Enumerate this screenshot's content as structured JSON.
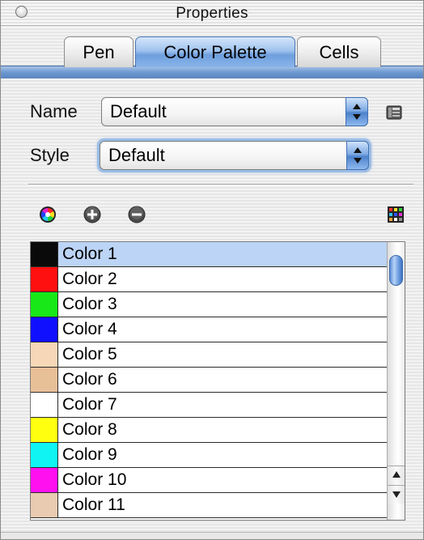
{
  "window": {
    "title": "Properties"
  },
  "tabs": [
    {
      "label": "Pen",
      "selected": false
    },
    {
      "label": "Color Palette",
      "selected": true
    },
    {
      "label": "Cells",
      "selected": false
    }
  ],
  "form": {
    "name_label": "Name",
    "name_value": "Default",
    "style_label": "Style",
    "style_value": "Default"
  },
  "toolbar": {
    "icons": [
      "color-wheel-icon",
      "add-icon",
      "remove-icon",
      "palette-grid-icon"
    ]
  },
  "colors": [
    {
      "label": "Color 1",
      "swatch": "#0a0a0a",
      "selected": true
    },
    {
      "label": "Color 2",
      "swatch": "#ff1010"
    },
    {
      "label": "Color 3",
      "swatch": "#18e818"
    },
    {
      "label": "Color 4",
      "swatch": "#1010ff"
    },
    {
      "label": "Color 5",
      "swatch": "#f6d8b8"
    },
    {
      "label": "Color 6",
      "swatch": "#e8c098"
    },
    {
      "label": "Color 7",
      "swatch": "#ffffff"
    },
    {
      "label": "Color 8",
      "swatch": "#ffff10"
    },
    {
      "label": "Color 9",
      "swatch": "#10f4f4"
    },
    {
      "label": "Color 10",
      "swatch": "#ff10ee"
    },
    {
      "label": "Color 11",
      "swatch": "#e8cbb0"
    }
  ],
  "theme": {
    "accent": "#6e9edd",
    "selection": "#bcd4f5"
  }
}
